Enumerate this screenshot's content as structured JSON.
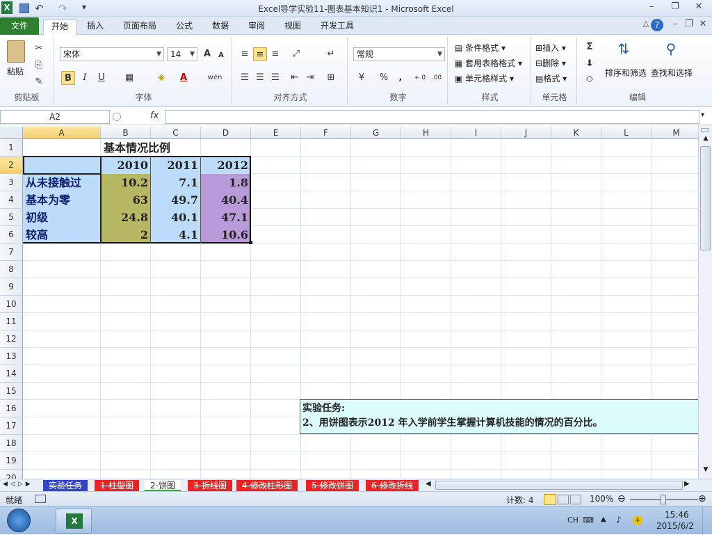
{
  "window": {
    "title": "Excel导学实验11-图表基本知识1  -  Microsoft Excel"
  },
  "qat": {
    "excel_logo": "X",
    "undo": "↶",
    "redo": "↷",
    "customize": "▾"
  },
  "ribbon_tabs": [
    "文件",
    "开始",
    "插入",
    "页面布局",
    "公式",
    "数据",
    "审阅",
    "视图",
    "开发工具"
  ],
  "ribbon": {
    "clipboard": {
      "paste": "粘贴",
      "label": "剪贴板"
    },
    "font": {
      "name": "宋体",
      "size": "14",
      "label": "字体",
      "bold": "B",
      "italic": "I",
      "underline": "U",
      "grow": "A",
      "shrink": "A",
      "font_color": "A",
      "wen": "wén"
    },
    "alignment": {
      "label": "对齐方式"
    },
    "number": {
      "format": "常规",
      "label": "数字",
      "percent": "%",
      "comma": ","
    },
    "styles": {
      "conditional": "条件格式",
      "table": "套用表格格式",
      "cell": "单元格样式",
      "label": "样式"
    },
    "cells": {
      "insert": "插入",
      "delete": "删除",
      "format": "格式",
      "label": "单元格"
    },
    "editing": {
      "sum": "Σ",
      "sort": "排序和筛选",
      "find": "查找和选择",
      "label": "编辑"
    }
  },
  "formula_bar": {
    "name_box": "A2",
    "fx": "fx",
    "value": ""
  },
  "columns": [
    "A",
    "B",
    "C",
    "D",
    "E",
    "F",
    "G",
    "H",
    "I",
    "J",
    "K",
    "L",
    "M"
  ],
  "rows": [
    "1",
    "2",
    "3",
    "4",
    "5",
    "6",
    "7",
    "8",
    "9",
    "10",
    "11",
    "12",
    "13",
    "14",
    "15",
    "16",
    "17",
    "18",
    "19",
    "20"
  ],
  "table": {
    "title": "基本情况比例",
    "years": [
      "2010",
      "2011",
      "2012"
    ],
    "rows": [
      {
        "label": "从未接触过",
        "values": [
          "10.2",
          "7.1",
          "1.8"
        ]
      },
      {
        "label": "基本为零",
        "values": [
          "63",
          "49.7",
          "40.4"
        ]
      },
      {
        "label": "初级",
        "values": [
          "24.8",
          "40.1",
          "47.1"
        ]
      },
      {
        "label": "较高",
        "values": [
          "2",
          "4.1",
          "10.6"
        ]
      }
    ]
  },
  "task_box": {
    "title": "实验任务:",
    "text": "2、用饼图表示2012 年入学前学生掌握计算机技能的情况的百分比。"
  },
  "sheet_tabs": [
    "实验任务",
    "1-柱型图",
    "2-饼图",
    "3-折线图",
    "4-修改柱形图",
    "5-修改饼图",
    "6-修改折线"
  ],
  "status": {
    "ready": "就绪",
    "count": "计数: 4",
    "zoom": "100%"
  },
  "taskbar": {
    "time": "15:46",
    "date": "2015/6/2",
    "lang": "CH"
  },
  "colors": {
    "label_bg": "#bcdcf9",
    "b_col": "#b8b864",
    "c_col": "#bcdcf9",
    "d_col": "#b89ad8",
    "text_blue": "#0c1f6e",
    "file_tab": "#2d7f2f"
  }
}
